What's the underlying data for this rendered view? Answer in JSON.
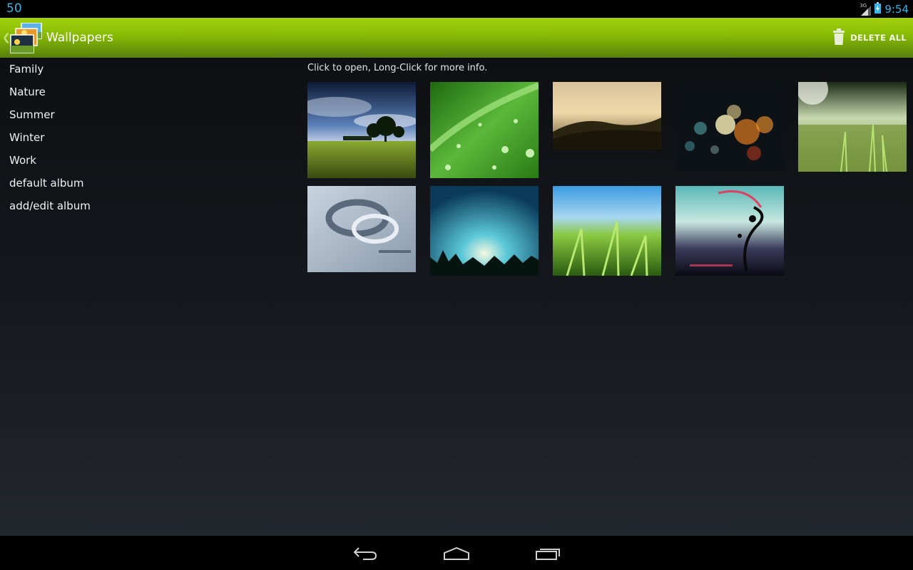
{
  "status_bar": {
    "notification_count": "50",
    "network_type": "3G",
    "time": "9:54",
    "icons": [
      "signal-icon",
      "battery-charging-icon"
    ],
    "accent_color": "#33b5e5"
  },
  "action_bar": {
    "title": "Wallpapers",
    "delete_all_label": "DELETE ALL",
    "icons": [
      "up-chevron-icon",
      "app-icon",
      "trash-icon"
    ],
    "accent_color": "#86ba05"
  },
  "albums": [
    {
      "label": "Family"
    },
    {
      "label": "Nature"
    },
    {
      "label": "Summer"
    },
    {
      "label": "Winter"
    },
    {
      "label": "Work"
    },
    {
      "label": "default album"
    },
    {
      "label": "add/edit album"
    }
  ],
  "gallery": {
    "hint": "Click to open, Long-Click for more info.",
    "thumbnails": [
      "landscape-trees",
      "leaf-water-drops",
      "grassy-hill-sunset",
      "bokeh-lights",
      "grass-dew-sunlight",
      "abstract-silver-rings",
      "blue-light-grass",
      "green-grass-blue-sky",
      "grunge-floral-art"
    ]
  },
  "nav_bar": {
    "icons": [
      "back-icon",
      "home-icon",
      "recent-apps-icon"
    ]
  }
}
